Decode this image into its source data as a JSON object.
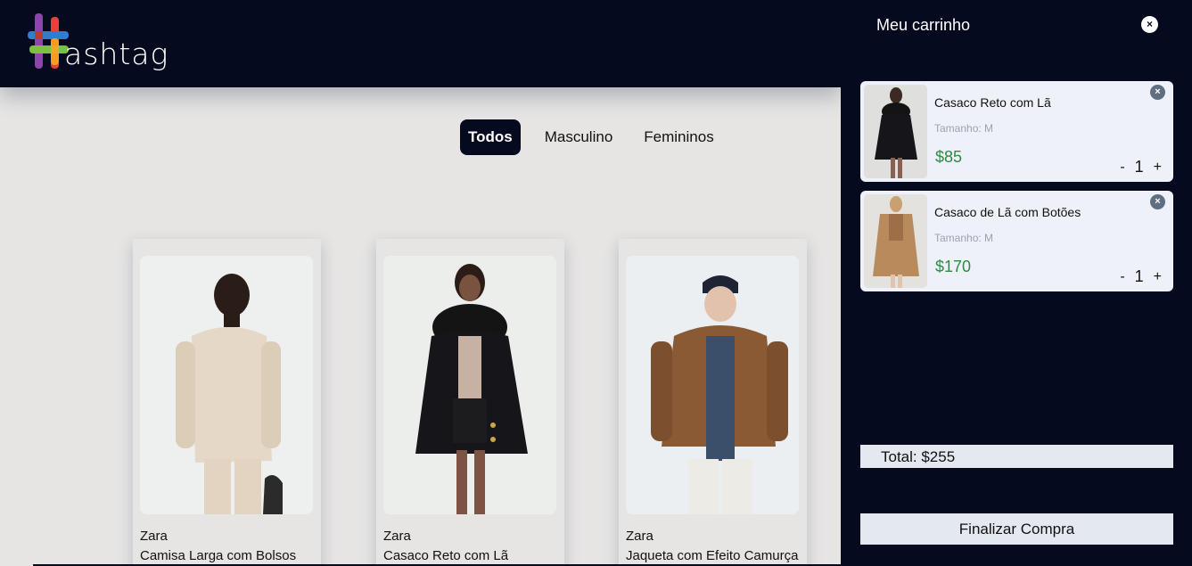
{
  "header": {
    "logo_text": "ashtag",
    "logo_colors": [
      "#e8413a",
      "#f6a623",
      "#7bc043",
      "#2f7dd1",
      "#8e44ad"
    ]
  },
  "filters": [
    {
      "label": "Todos",
      "active": true
    },
    {
      "label": "Masculino",
      "active": false
    },
    {
      "label": "Femininos",
      "active": false
    }
  ],
  "products": [
    {
      "brand": "Zara",
      "name": "Camisa Larga com Bolsos",
      "icon": "man-cream-shirt-photo"
    },
    {
      "brand": "Zara",
      "name": "Casaco Reto com Lã",
      "icon": "woman-black-coat-photo"
    },
    {
      "brand": "Zara",
      "name": "Jaqueta com Efeito Camurça",
      "icon": "man-brown-jacket-photo"
    }
  ],
  "cart": {
    "title": "Meu carrinho",
    "close_glyph": "×",
    "items": [
      {
        "name": "Casaco Reto com Lã",
        "size": "Tamanho: M",
        "price": "$85",
        "qty": "1",
        "minus": "-",
        "plus": "+",
        "remove": "×"
      },
      {
        "name": "Casaco de Lã com Botões",
        "size": "Tamanho: M",
        "price": "$170",
        "qty": "1",
        "minus": "-",
        "plus": "+",
        "remove": "×"
      }
    ],
    "total": "Total: $255",
    "checkout_label": "Finalizar Compra"
  },
  "colors": {
    "navy": "#050a1e",
    "price_green": "#2e8a44",
    "page_bg": "#e6e5e3"
  }
}
